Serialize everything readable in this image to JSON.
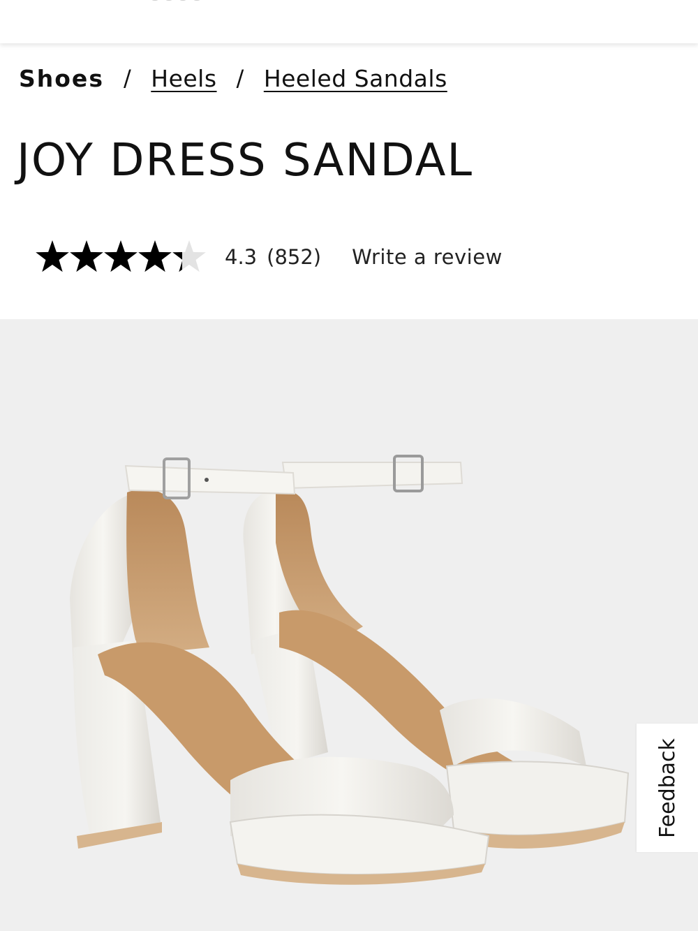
{
  "breadcrumb": {
    "items": [
      "Shoes",
      "Heels",
      "Heeled Sandals"
    ],
    "separator": "/"
  },
  "product": {
    "title": "JOY DRESS SANDAL",
    "rating": {
      "value": "4.3",
      "count": "(852)",
      "stars_filled": 4.3,
      "stars_max": 5,
      "write_review_label": "Write a review"
    },
    "image_icon": "product-photo"
  },
  "feedback": {
    "label": "Feedback"
  },
  "colors": {
    "star": "#000000",
    "star_empty": "#e3e3e3",
    "image_background": "#efefef"
  }
}
